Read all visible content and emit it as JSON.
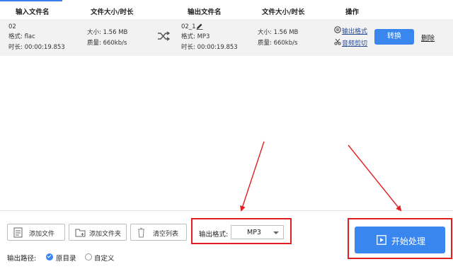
{
  "header": {
    "input_name": "输入文件名",
    "size_duration_1": "文件大小/时长",
    "output_name": "输出文件名",
    "size_duration_2": "文件大小/时长",
    "operation": "操作"
  },
  "file_row": {
    "input_name": "02",
    "input_format": "格式:  flac",
    "input_duration": "时长:  00:00:19.853",
    "input_size": "大小:  1.56 MB",
    "input_quality": "质量:  660kb/s",
    "output_name": "02_1",
    "output_format": "格式:  MP3",
    "output_duration": "时长:  00:00:19.853",
    "output_size": "大小:  1.56 MB",
    "output_quality": "质量:  660kb/s",
    "output_format_link": "输出格式",
    "audio_cut_link": "音频剪切",
    "convert_label": "转换",
    "delete_label": "删除"
  },
  "toolbar": {
    "add_file": "添加文件",
    "add_folder": "添加文件夹",
    "clear_list": "清空列表",
    "output_format_label": "输出格式:",
    "output_format_value": "MP3",
    "start_label": "开始处理",
    "output_path_label": "输出路径:",
    "path_option_original": "原目录",
    "path_option_custom": "自定义",
    "path_selected": "原目录"
  },
  "colors": {
    "accent": "#3a86ef",
    "annotation_red": "#e02020",
    "row_background": "#f2f2f2"
  }
}
